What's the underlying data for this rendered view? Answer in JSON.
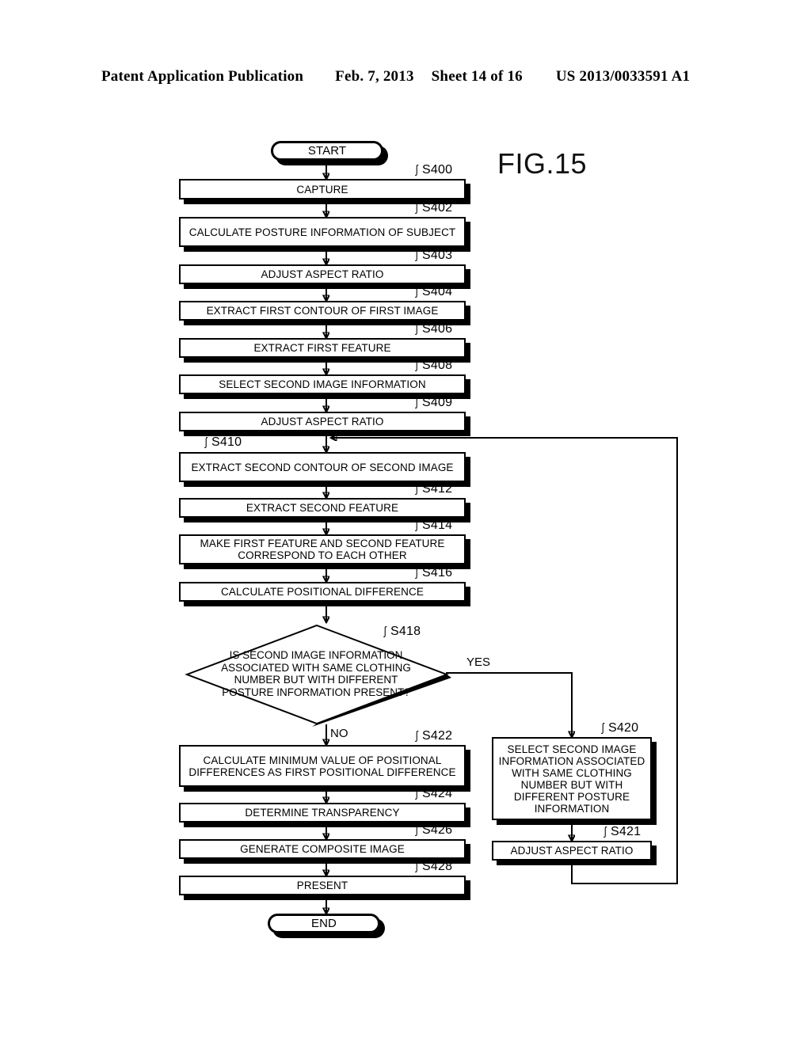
{
  "header": {
    "publication": "Patent Application Publication",
    "date": "Feb. 7, 2013",
    "sheet": "Sheet 14 of 16",
    "number": "US 2013/0033591 A1"
  },
  "figure": {
    "label": "FIG.15"
  },
  "flowchart": {
    "start": "START",
    "end": "END",
    "branch_yes": "YES",
    "branch_no": "NO",
    "steps": [
      {
        "ref": "S400",
        "text": "CAPTURE"
      },
      {
        "ref": "S402",
        "text": "CALCULATE POSTURE INFORMATION OF SUBJECT"
      },
      {
        "ref": "S403",
        "text": "ADJUST ASPECT RATIO"
      },
      {
        "ref": "S404",
        "text": "EXTRACT FIRST CONTOUR OF FIRST IMAGE"
      },
      {
        "ref": "S406",
        "text": "EXTRACT FIRST FEATURE"
      },
      {
        "ref": "S408",
        "text": "SELECT SECOND IMAGE INFORMATION"
      },
      {
        "ref": "S409",
        "text": "ADJUST ASPECT RATIO"
      },
      {
        "ref": "S410",
        "text": "EXTRACT SECOND CONTOUR OF SECOND IMAGE"
      },
      {
        "ref": "S412",
        "text": "EXTRACT SECOND FEATURE"
      },
      {
        "ref": "S414",
        "text": "MAKE FIRST FEATURE AND SECOND FEATURE CORRESPOND TO EACH OTHER"
      },
      {
        "ref": "S416",
        "text": "CALCULATE POSITIONAL DIFFERENCE"
      },
      {
        "ref": "S418",
        "text": "IS SECOND IMAGE INFORMATION ASSOCIATED WITH SAME CLOTHING NUMBER BUT WITH DIFFERENT POSTURE INFORMATION PRESENT?"
      },
      {
        "ref": "S420",
        "text": "SELECT SECOND IMAGE INFORMATION ASSOCIATED WITH SAME CLOTHING NUMBER BUT WITH DIFFERENT POSTURE INFORMATION"
      },
      {
        "ref": "S421",
        "text": "ADJUST ASPECT RATIO"
      },
      {
        "ref": "S422",
        "text": "CALCULATE MINIMUM VALUE OF POSITIONAL DIFFERENCES AS FIRST POSITIONAL DIFFERENCE"
      },
      {
        "ref": "S424",
        "text": "DETERMINE TRANSPARENCY"
      },
      {
        "ref": "S426",
        "text": "GENERATE COMPOSITE IMAGE"
      },
      {
        "ref": "S428",
        "text": "PRESENT"
      }
    ]
  },
  "colors": {
    "ink": "#000000",
    "paper": "#ffffff"
  }
}
